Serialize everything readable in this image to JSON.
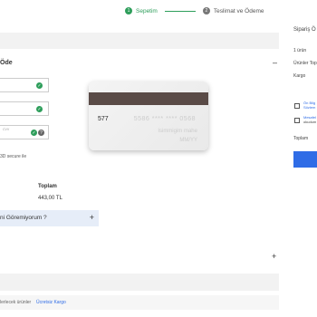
{
  "stepper": {
    "step1_num": "1",
    "step1_label": "Sepetim",
    "step2_num": "2",
    "step2_label": "Teslimat ve Ödeme",
    "active_color": "#2e9e5b"
  },
  "payment": {
    "section_title": "Öde",
    "collapse_icon": "–",
    "card_back": {
      "cvv": "577",
      "number_mask": "5586 **** **** 0568",
      "note_line1": "Isimmigim mahe",
      "note_line2": "MM/YY"
    },
    "input_hint": "3D secure ile",
    "cvv_hint": "CVV"
  },
  "summary_table": {
    "header": "Toplam",
    "value": "443,00 TL"
  },
  "faq": {
    "label": "ni Göremiyorum ?",
    "plus": "+"
  },
  "section_plus": "+",
  "footer": {
    "text_before": "lerlecek ürünler",
    "link": "Ücretsiz Kargo"
  },
  "right_summary": {
    "title": "Sipariş Ö",
    "count": "1 ürün",
    "products_total_label": "Ürünler Top",
    "shipping_label": "Kargo",
    "check1_line1": "Ön Bilg",
    "check1_line2": "Sözlem",
    "check2_line1": "Mesafel",
    "check2_line2": "okudum",
    "total_label": "Toplam"
  }
}
